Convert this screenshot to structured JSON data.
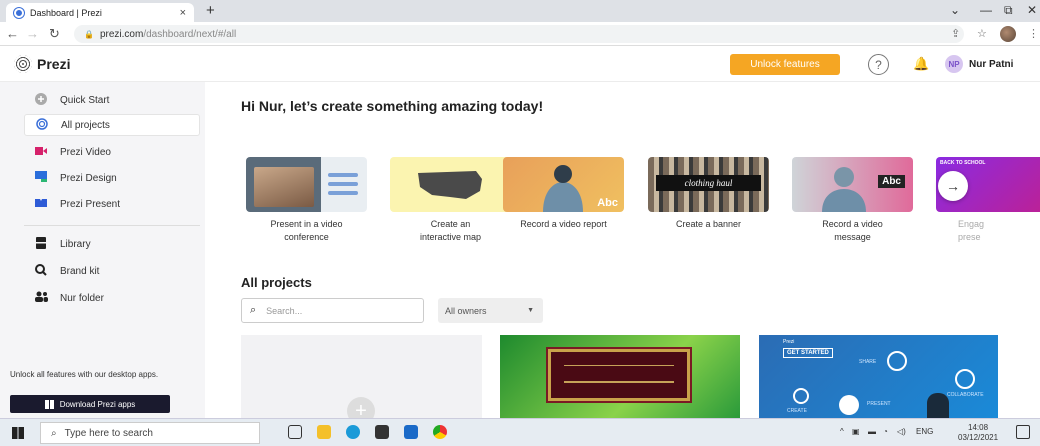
{
  "browser": {
    "tab_title": "Dashboard | Prezi",
    "tab_close": "×",
    "new_tab": "+",
    "url_host": "prezi.com",
    "url_path": "/dashboard/next/#/all",
    "minimize": "—",
    "restore": "⧉",
    "close": "✕",
    "chevron": "⌄"
  },
  "header": {
    "logo_text": "Prezi",
    "unlock_label": "Unlock features",
    "help": "?",
    "user_initials": "NP",
    "user_name": "Nur Patni"
  },
  "sidebar": {
    "items": [
      {
        "label": "Quick Start",
        "icon": "plus-circle-icon"
      },
      {
        "label": "All projects",
        "icon": "prezi-swirl-icon"
      },
      {
        "label": "Prezi Video",
        "icon": "video-camera-icon"
      },
      {
        "label": "Prezi Design",
        "icon": "design-icon"
      },
      {
        "label": "Prezi Present",
        "icon": "present-icon"
      },
      {
        "label": "Library",
        "icon": "library-icon"
      },
      {
        "label": "Brand kit",
        "icon": "brand-kit-icon"
      },
      {
        "label": "Nur folder",
        "icon": "users-folder-icon"
      }
    ],
    "footer_text": "Unlock all features with our desktop apps.",
    "download_label": "Download Prezi apps",
    "colors": {
      "video": "#d6216b",
      "design": "#2a6edb",
      "present": "#2e5bd6"
    }
  },
  "main": {
    "greeting": "Hi Nur, let’s create something amazing today!",
    "cards": [
      {
        "line1": "Present in a video",
        "line2": "conference"
      },
      {
        "line1": "Create an",
        "line2": "interactive map"
      },
      {
        "line1": "Record a video report",
        "line2": ""
      },
      {
        "line1": "Create a banner",
        "line2": ""
      },
      {
        "line1": "Record a video",
        "line2": "message"
      },
      {
        "line1": "Engag",
        "line2": "prese"
      }
    ],
    "card_overlays": {
      "abc": "Abc",
      "clothing": "clothing haul",
      "back_to_school": "BACK TO SCHOOL"
    },
    "section_title": "All projects",
    "search_placeholder": "Search...",
    "owners_value": "All owners",
    "project_texts": {
      "get_started": "GET STARTED",
      "present": "PRESENT",
      "create": "CREATE",
      "share": "SHARE",
      "collaborate": "COLLABORATE",
      "prezi": "Prezi"
    }
  },
  "taskbar": {
    "search_placeholder": "Type here to search",
    "lang": "ENG",
    "time": "14:08",
    "date": "03/12/2021"
  }
}
